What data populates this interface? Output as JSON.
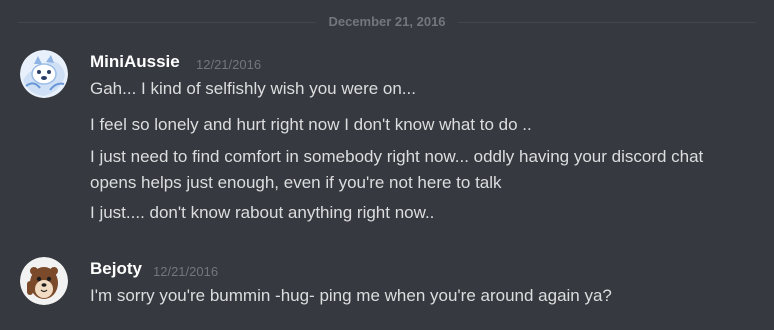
{
  "date_divider": "December 21, 2016",
  "messages": [
    {
      "username": "MiniAussie",
      "timestamp": "12/21/2016",
      "avatar_icon": "husky-avatar-icon",
      "lines": [
        "Gah... I kind of selfishly wish you were on...",
        "I feel so lonely and hurt right now I don't know what to do ..",
        "I just need to find comfort in somebody right now... oddly having your discord chat opens helps just enough, even if you're not here to talk",
        "I just.... don't know rabout anything right now.."
      ]
    },
    {
      "username": "Bejoty",
      "timestamp": "12/21/2016",
      "avatar_icon": "otter-avatar-icon",
      "lines": [
        "I'm sorry you're bummin -hug- ping me when you're around again ya?"
      ]
    }
  ],
  "colors": {
    "background": "#36393f",
    "username": "#ffffff",
    "message_text": "#dcddde",
    "muted_text": "#72767d",
    "divider": "#42454a"
  }
}
